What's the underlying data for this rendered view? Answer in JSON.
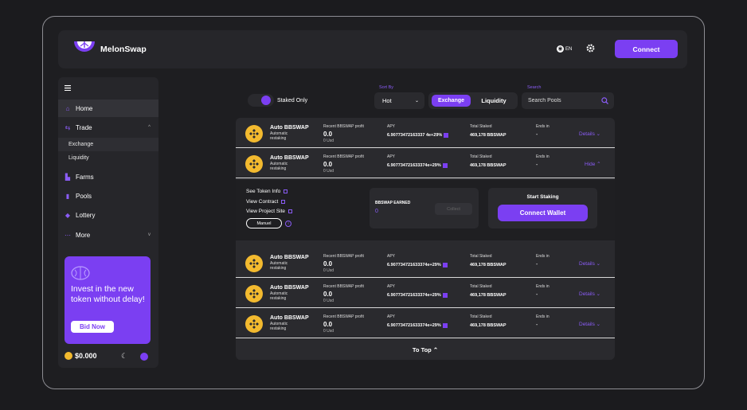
{
  "header": {
    "brand": "MelonSwap",
    "lang": "EN",
    "connect_label": "Connect"
  },
  "sidebar": {
    "nav": [
      {
        "label": "Home",
        "icon": "home-icon"
      },
      {
        "label": "Trade",
        "icon": "trade-icon"
      },
      {
        "label": "Farms",
        "icon": "farms-icon"
      },
      {
        "label": "Pools",
        "icon": "pools-icon"
      },
      {
        "label": "Lottery",
        "icon": "lottery-icon"
      },
      {
        "label": "More",
        "icon": "more-icon"
      }
    ],
    "trade_sub": [
      "Exchange",
      "Liquidity"
    ],
    "promo_text": "Invest in the new token without delay!",
    "bid_label": "Bid Now",
    "balance": "$0.000"
  },
  "filters": {
    "staked_only": "Staked Only",
    "sort_label": "Sort By",
    "sort_value": "Hot",
    "exchange": "Exchange",
    "liquidity": "Liquidity",
    "search_label": "Search",
    "search_placeholder": "Search Pools"
  },
  "pools": {
    "rows": [
      {
        "name": "Auto BBSWAP",
        "sub": "Automatic restaking",
        "profit_label": "Recent BBSWAP profit",
        "profit": "0.0",
        "usd": "0 Usd",
        "apy_label": "APY",
        "apy": "6.90773472163337 4e+29%",
        "staked_label": "Total Staked",
        "staked": "469,178 BBSWAP",
        "ends_label": "Ends in",
        "ends": "-",
        "action": "Details ⌄"
      },
      {
        "name": "Auto BBSWAP",
        "sub": "Automatic restaking",
        "profit_label": "Recent BBSWAP profit",
        "profit": "0.0",
        "usd": "0 Usd",
        "apy_label": "APY",
        "apy": "6.907734721633374e+29%",
        "staked_label": "Total Staked",
        "staked": "469,178 BBSWAP",
        "ends_label": "Ends in",
        "ends": "-",
        "action": "Hide ⌃"
      },
      {
        "name": "Auto BBSWAP",
        "sub": "Automatic restaking",
        "profit_label": "Recent BBSWAP profit",
        "profit": "0.0",
        "usd": "0 Usd",
        "apy_label": "APY",
        "apy": "6.907734721633374e+29%",
        "staked_label": "Total Staked",
        "staked": "469,178 BBSWAP",
        "ends_label": "Ends in",
        "ends": "-",
        "action": "Details ⌄"
      },
      {
        "name": "Auto BBSWAP",
        "sub": "Automatic restaking",
        "profit_label": "Recent BBSWAP profit",
        "profit": "0.0",
        "usd": "0 Usd",
        "apy_label": "APY",
        "apy": "6.907734721633374e+29%",
        "staked_label": "Total Staked",
        "staked": "469,178 BBSWAP",
        "ends_label": "Ends in",
        "ends": "-",
        "action": "Details ⌄"
      },
      {
        "name": "Auto BBSWAP",
        "sub": "Automatic restaking",
        "profit_label": "Recent BBSWAP profit",
        "profit": "0.0",
        "usd": "0 Usd",
        "apy_label": "APY",
        "apy": "6.907734721633374e+29%",
        "staked_label": "Total Staked",
        "staked": "469,178 BBSWAP",
        "ends_label": "Ends in",
        "ends": "-",
        "action": "Details ⌄"
      }
    ],
    "expanded": {
      "token_info": "See Token Info",
      "contract": "View Contract",
      "project": "View Project Site",
      "manual": "Manuel",
      "earned_label": "BBSWAP EARNED",
      "earned_value": "0",
      "collect": "Collect",
      "start_staking": "Start Staking",
      "connect_wallet": "Connect Wallet"
    },
    "to_top": "To Top ⌃"
  },
  "colors": {
    "accent": "#7b3ff2",
    "token": "#f3ba2f"
  }
}
